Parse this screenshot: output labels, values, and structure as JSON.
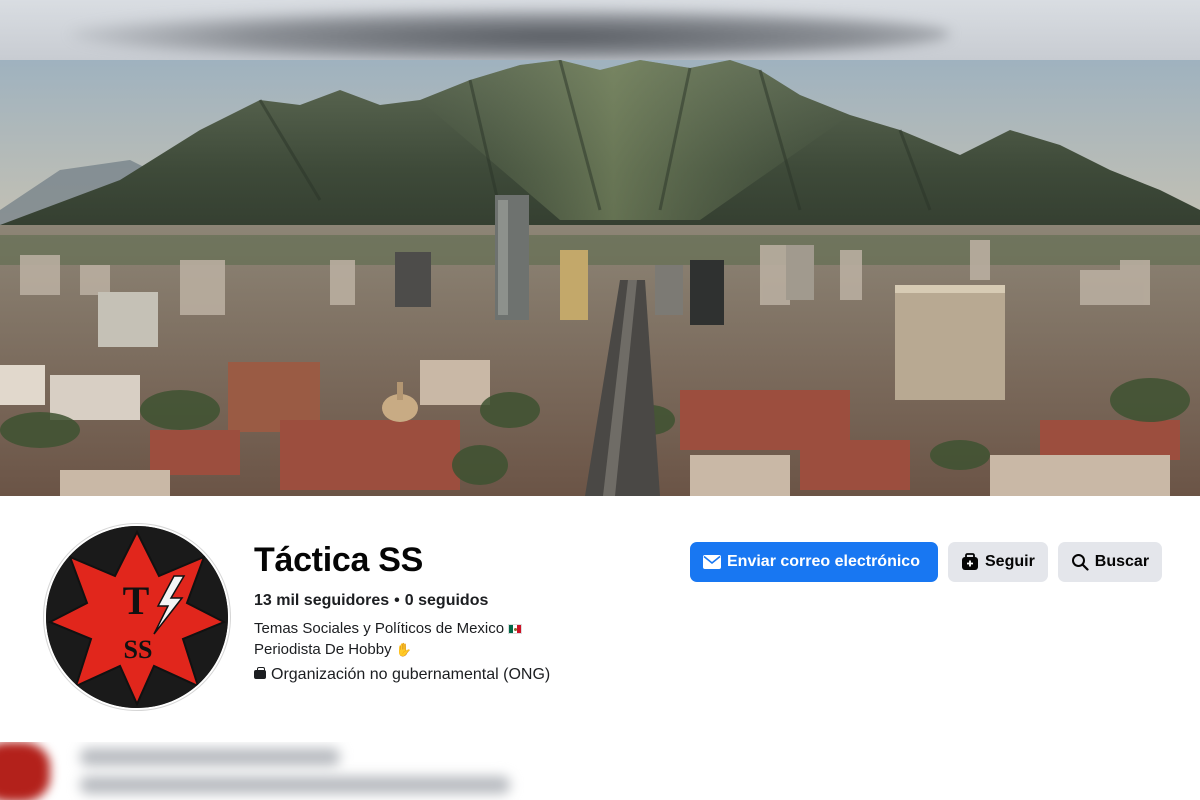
{
  "page": {
    "name": "Táctica SS",
    "followers_label": "13 mil seguidores",
    "following_label": "0 seguidos",
    "separator": "•",
    "bio_line1": "Temas Sociales y Políticos de Mexico",
    "bio_line2": "Periodista De Hobby",
    "category": "Organización no gubernamental (ONG)"
  },
  "avatar": {
    "letter_top": "T",
    "letter_bottom": "SS"
  },
  "actions": {
    "email_label": "Enviar correo electrónico",
    "follow_label": "Seguir",
    "search_label": "Buscar"
  },
  "colors": {
    "primary": "#1877f2",
    "secondary_button": "#e4e6eb",
    "avatar_star": "#e1261c"
  },
  "icons": {
    "email": "envelope-icon",
    "follow": "follow-icon",
    "search": "search-icon",
    "category": "briefcase-icon",
    "flag": "mexico-flag-icon",
    "arm": "flexed-arm-icon"
  }
}
